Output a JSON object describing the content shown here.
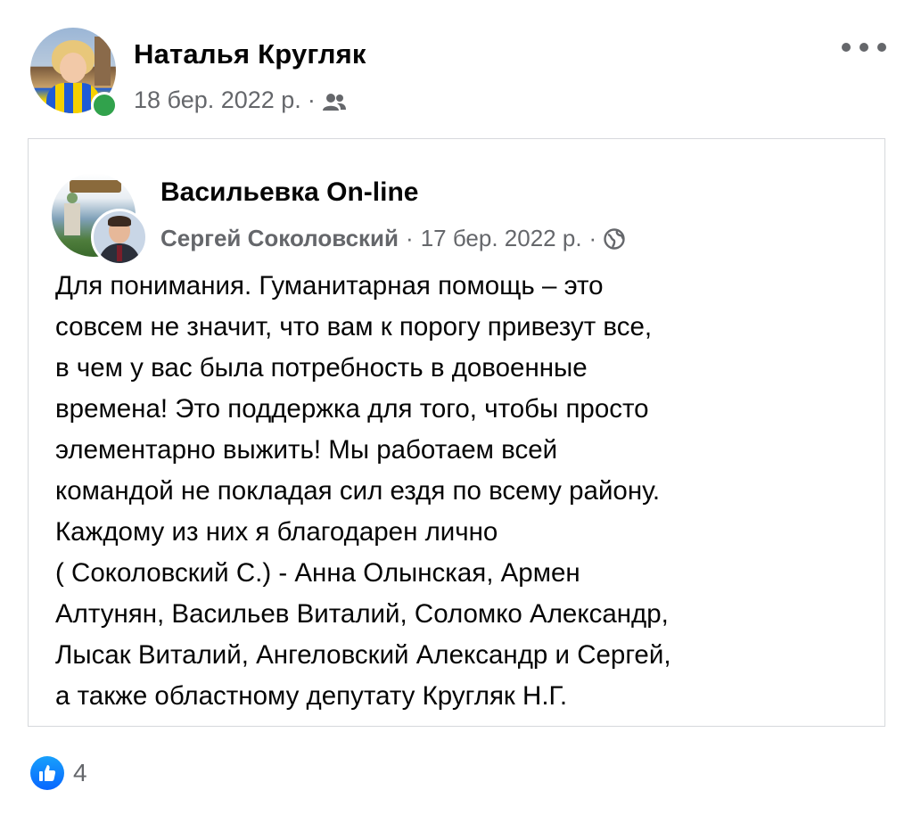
{
  "post": {
    "author": "Наталья Кругляк",
    "date": "18 бер. 2022 р.",
    "separator": "·",
    "audience_icon": "friends-icon",
    "more_icon": "more-options-icon"
  },
  "shared_post": {
    "page_name": "Васильевка On-line",
    "poster": "Сергей Соколовский",
    "separator_1": "·",
    "date": "17 бер. 2022 р.",
    "separator_2": "·",
    "audience_icon": "globe-icon",
    "body_lines": [
      "Для понимания. Гуманитарная помощь – это",
      "совсем не значит, что вам к порогу привезут все,",
      "в чем у вас была потребность в довоенные",
      "времена! Это поддержка для того, чтобы просто",
      "элементарно выжить! Мы работаем всей",
      "командой не покладая сил ездя по всему району.",
      "Каждому из них я благодарен лично",
      "( Соколовский С.) - Анна Олынская, Армен",
      "Алтунян, Васильев Виталий, Соломко Александр,",
      "Лысак Виталий, Ангеловский Александр и Сергей,",
      "а также областному депутату Кругляк Н.Г."
    ]
  },
  "reactions": {
    "icon": "like-icon",
    "count": "4"
  },
  "colors": {
    "primary_text": "#050505",
    "secondary_text": "#65676b",
    "online": "#31a24c",
    "like_blue": "#0866ff",
    "border": "#d6d8dc"
  }
}
